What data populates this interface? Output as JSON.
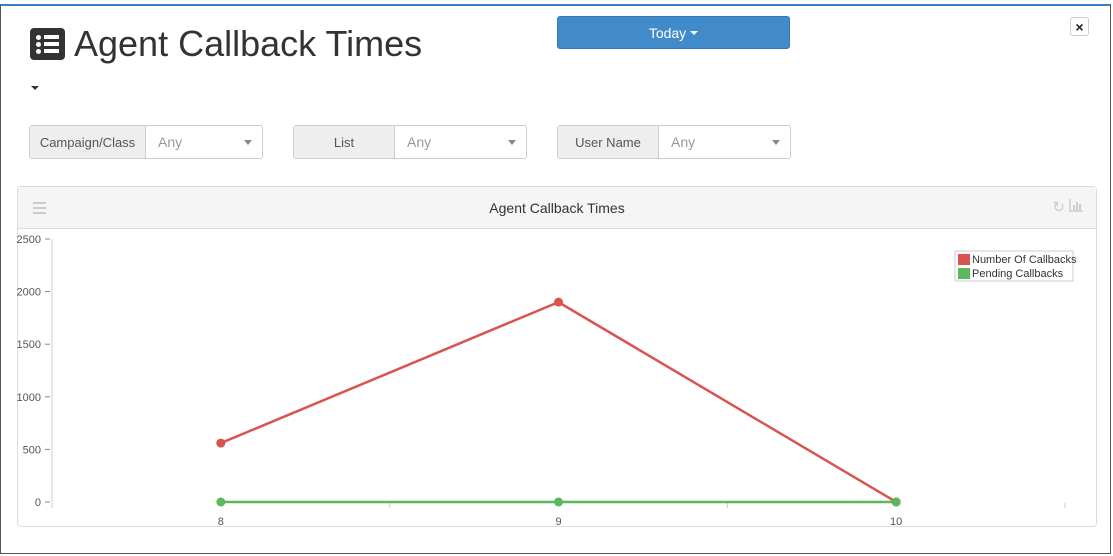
{
  "header": {
    "title": "Agent Callback Times",
    "title_icon": "list-alt-icon",
    "date_range_button": "Today",
    "close_label": "×"
  },
  "filters": [
    {
      "label": "Campaign/Class",
      "value": "Any"
    },
    {
      "label": "List",
      "value": "Any"
    },
    {
      "label": "User Name",
      "value": "Any"
    }
  ],
  "panel": {
    "title": "Agent Callback Times",
    "tools": [
      "refresh-icon",
      "bar-chart-icon"
    ]
  },
  "chart_data": {
    "type": "line",
    "title": "Agent Callback Times",
    "x": [
      8,
      9,
      10
    ],
    "x_tick_labels": [
      "8",
      "9",
      "10"
    ],
    "xlim": [
      7.5,
      10.5
    ],
    "series": [
      {
        "name": "Number Of Callbacks",
        "color": "#d9534f",
        "values": [
          560,
          1900,
          0
        ]
      },
      {
        "name": "Pending Callbacks",
        "color": "#5cb85c",
        "values": [
          0,
          0,
          0
        ]
      }
    ],
    "ylim": [
      0,
      2500
    ],
    "y_ticks": [
      0,
      500,
      1000,
      1500,
      2000,
      2500
    ],
    "xlabel": "",
    "ylabel": "",
    "grid": false,
    "legend_position": "top-right"
  }
}
